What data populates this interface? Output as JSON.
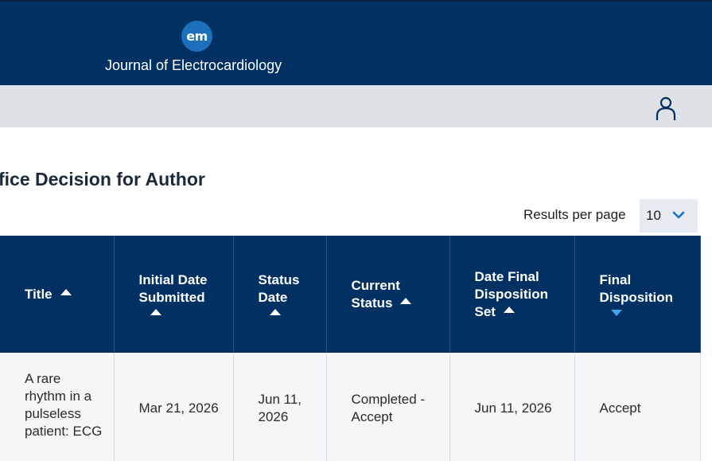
{
  "header": {
    "logo_text": "em",
    "journal_name": "Journal of Electrocardiology"
  },
  "nav": {
    "user_icon": "user-icon"
  },
  "page": {
    "title": "fice Decision for Author"
  },
  "pagination": {
    "results_per_page_label": "Results per page",
    "results_per_page_value": "10"
  },
  "table": {
    "columns": [
      {
        "label": "Title",
        "sort": "asc"
      },
      {
        "label": "Initial Date Submitted",
        "sort": "asc"
      },
      {
        "label": "Status Date",
        "sort": "asc"
      },
      {
        "label": "Current Status",
        "sort": "asc"
      },
      {
        "label": "Date Final Disposition Set",
        "sort": "asc"
      },
      {
        "label": "Final Disposition",
        "sort": "desc"
      }
    ],
    "rows": [
      {
        "title": "A rare rhythm in a pulseless patient: ECG",
        "initial_date_submitted": "Mar 21, 2026",
        "status_date": "Jun 11, 2026",
        "current_status": "Completed - Accept",
        "date_final_disposition_set": "Jun 11, 2026",
        "final_disposition": "Accept"
      }
    ]
  },
  "colors": {
    "header_bg": "#013062",
    "nav_bg": "#dfe2e6",
    "logo_bg": "#1c6fba",
    "sort_active": "#3fa6f0",
    "select_bg": "#e6ebf1"
  }
}
